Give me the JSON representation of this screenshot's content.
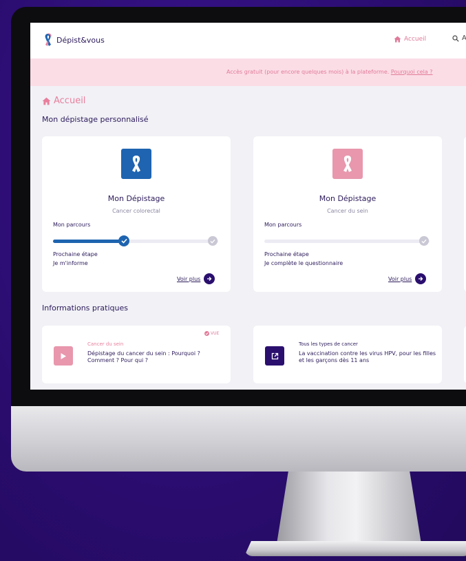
{
  "app": {
    "name": "Dépist&vous"
  },
  "nav": {
    "home_label": "Accueil",
    "search_label": "A"
  },
  "banner": {
    "text": "Accès gratuit (pour encore quelques mois) à la plateforme. ",
    "link": "Pourquoi cela ?"
  },
  "breadcrumb": "Accueil",
  "section1": "Mon dépistage personnalisé",
  "cards": [
    {
      "title": "Mon Dépistage",
      "subtitle": "Cancer colorectal",
      "journey_label": "Mon parcours",
      "progress": 0.42,
      "next_label": "Prochaine étape",
      "next_value": "Je m'informe",
      "more": "Voir plus",
      "icon_color": "#1e64b0"
    },
    {
      "title": "Mon Dépistage",
      "subtitle": "Cancer du sein",
      "journey_label": "Mon parcours",
      "progress": 0,
      "next_label": "Prochaine étape",
      "next_value": "Je complète le questionnaire",
      "more": "Voir plus",
      "icon_color": "#e897ad"
    }
  ],
  "section2": "Informations pratiques",
  "infos": [
    {
      "badge": "VUE",
      "category": "Cancer du sein",
      "text": "Dépistage du cancer du sein : Pourquoi ? Comment ? Pour qui ?",
      "icon": "play-icon",
      "icon_color": "#e897ad"
    },
    {
      "category": "Tous les types de cancer",
      "text": "La vaccination contre les virus HPV, pour les filles et les garçons dès 11 ans",
      "icon": "external-link-icon",
      "icon_color": "#2a0f6e"
    }
  ],
  "colors": {
    "background": "#2a0c6e",
    "accent_pink": "#e87f9c",
    "navy": "#2c1a5a",
    "blue": "#1e64b0",
    "banner_bg": "#fbdde6"
  }
}
